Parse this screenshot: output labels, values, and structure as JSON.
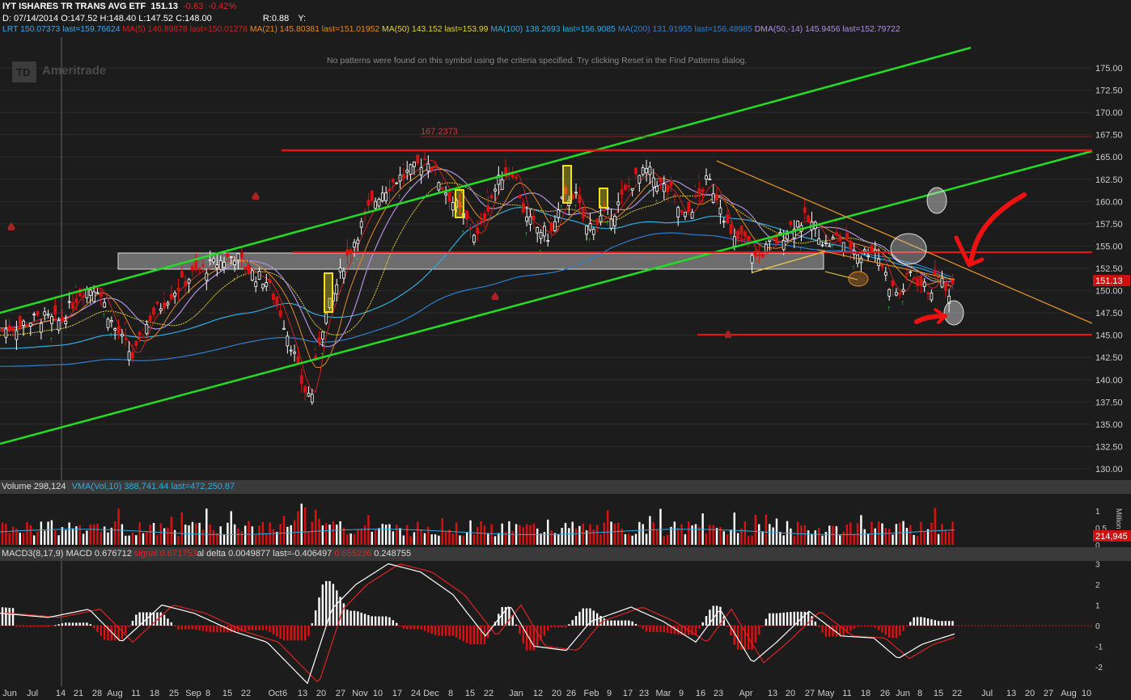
{
  "header": {
    "symbol_line": "IYT ISHARES TR TRANS AVG ETF",
    "price": "151.13",
    "change": "-0.63",
    "change_pct": "-0.42%",
    "ohlc_date": "D: 07/14/2014",
    "open": "O:147.52",
    "high": "H:148.40",
    "low": "L:147.52",
    "close": "C:148.00",
    "r": "R:0.88",
    "y": "Y:"
  },
  "studies": [
    {
      "text": "LRT",
      "color": "#4aa3e0"
    },
    {
      "text": "150.07373 last=159.76624",
      "color": "#4aa3e0"
    },
    {
      "text": "MA(5)",
      "color": "#cc2222"
    },
    {
      "text": "146.89878 last=150.01278",
      "color": "#cc2222"
    },
    {
      "text": "MA(21)",
      "color": "#e08a2a"
    },
    {
      "text": "145.80381 last=151.01952",
      "color": "#e08a2a"
    },
    {
      "text": "MA(50)",
      "color": "#e0d040"
    },
    {
      "text": "143.152 last=153.99",
      "color": "#e0d040"
    },
    {
      "text": "MA(100)",
      "color": "#33aadd"
    },
    {
      "text": "138.2693 last=156.9085",
      "color": "#33aadd"
    },
    {
      "text": "MA(200)",
      "color": "#2f7fd0"
    },
    {
      "text": "131.91955 last=156.48985",
      "color": "#2f7fd0"
    },
    {
      "text": "DMA(50,-14)",
      "color": "#b090e0"
    },
    {
      "text": "145.9456 last=152.79722",
      "color": "#b090e0"
    }
  ],
  "watermark": "Ameritrade",
  "watermark_logo": "TD",
  "pattern_note": "No patterns were found on this symbol using the criteria specified.   Try clicking Reset in the Find Patterns dialog.",
  "high_label": "167.2373",
  "last_price_tag": "151.13",
  "volume_header": {
    "title": "Volume 298,124",
    "vma": "VMA(Vol,10)",
    "vma_values": "388,741.44 last=472,250.87"
  },
  "volume_last_tag": "214,945",
  "volume_unit": "Million",
  "macd_header": {
    "a": "MACD3(8,17,9)",
    "b": "MACD 0.676712",
    "c": "signal 0.671753",
    "d": "al delta 0.0049877 last=-0.406497",
    "e": "0.655236",
    "f": "0.248755"
  },
  "x_labels": [
    {
      "t": "Jun",
      "x": 12
    },
    {
      "t": "Jul",
      "x": 40
    },
    {
      "t": "14",
      "x": 75
    },
    {
      "t": "21",
      "x": 97
    },
    {
      "t": "28",
      "x": 120
    },
    {
      "t": "Aug",
      "x": 142
    },
    {
      "t": "11",
      "x": 168
    },
    {
      "t": "18",
      "x": 191
    },
    {
      "t": "25",
      "x": 215
    },
    {
      "t": "Sep",
      "x": 239
    },
    {
      "t": "8",
      "x": 257
    },
    {
      "t": "15",
      "x": 281
    },
    {
      "t": "22",
      "x": 304
    },
    {
      "t": "Oct",
      "x": 340
    },
    {
      "t": "6",
      "x": 352
    },
    {
      "t": "13",
      "x": 374
    },
    {
      "t": "20",
      "x": 397
    },
    {
      "t": "27",
      "x": 421
    },
    {
      "t": "Nov",
      "x": 445
    },
    {
      "t": "10",
      "x": 467
    },
    {
      "t": "17",
      "x": 491
    },
    {
      "t": "24",
      "x": 514
    },
    {
      "t": "Dec",
      "x": 533
    },
    {
      "t": "8",
      "x": 557
    },
    {
      "t": "15",
      "x": 581
    },
    {
      "t": "22",
      "x": 604
    },
    {
      "t": "Jan",
      "x": 638
    },
    {
      "t": "12",
      "x": 665
    },
    {
      "t": "20",
      "x": 688
    },
    {
      "t": "26",
      "x": 706
    },
    {
      "t": "Feb",
      "x": 731
    },
    {
      "t": "9",
      "x": 753
    },
    {
      "t": "17",
      "x": 776
    },
    {
      "t": "23",
      "x": 796
    },
    {
      "t": "Mar",
      "x": 820
    },
    {
      "t": "9",
      "x": 842
    },
    {
      "t": "16",
      "x": 866
    },
    {
      "t": "23",
      "x": 888
    },
    {
      "t": "Apr",
      "x": 922
    },
    {
      "t": "13",
      "x": 955
    },
    {
      "t": "20",
      "x": 977
    },
    {
      "t": "27",
      "x": 1001
    },
    {
      "t": "May",
      "x": 1021
    },
    {
      "t": "11",
      "x": 1047
    },
    {
      "t": "18",
      "x": 1070
    },
    {
      "t": "26",
      "x": 1094
    },
    {
      "t": "Jun",
      "x": 1116
    },
    {
      "t": "8",
      "x": 1137
    },
    {
      "t": "15",
      "x": 1160
    },
    {
      "t": "22",
      "x": 1183
    },
    {
      "t": "Jul",
      "x": 1220
    },
    {
      "t": "13",
      "x": 1250
    },
    {
      "t": "20",
      "x": 1273
    },
    {
      "t": "27",
      "x": 1296
    },
    {
      "t": "Aug",
      "x": 1321
    },
    {
      "t": "10",
      "x": 1343
    }
  ],
  "colors": {
    "up": "#ffffff",
    "down": "#dd1111",
    "green_line": "#22dd22",
    "red_line": "#ee1111",
    "orange_line": "#e0902a",
    "grid": "#2a2a2a",
    "axis_text": "#cccccc"
  },
  "chart_data": [
    {
      "type": "candlestick",
      "title": "IYT ISHARES TR TRANS AVG ETF",
      "ylim": [
        128.5,
        177.5
      ],
      "y_ticks": [
        "130.00",
        "132.50",
        "135.00",
        "137.50",
        "140.00",
        "142.50",
        "145.00",
        "147.50",
        "150.00",
        "152.50",
        "155.00",
        "157.50",
        "160.00",
        "162.50",
        "165.00",
        "167.50",
        "170.00",
        "172.50",
        "175.00"
      ],
      "x_range": [
        "Jun 2014",
        "Aug 10 2015"
      ],
      "close_path_approx": [
        {
          "date": "Jun 2014",
          "close": 145.5
        },
        {
          "date": "Jul 14",
          "close": 146.5
        },
        {
          "date": "Jul 28",
          "close": 150.5
        },
        {
          "date": "Aug 11",
          "close": 143.0
        },
        {
          "date": "Aug 25",
          "close": 150.0
        },
        {
          "date": "Sep 8",
          "close": 152.5
        },
        {
          "date": "Sep 22",
          "close": 152.0
        },
        {
          "date": "Oct 6",
          "close": 149.0
        },
        {
          "date": "Oct 13",
          "close": 138.5
        },
        {
          "date": "Oct 27",
          "close": 152.0
        },
        {
          "date": "Nov 10",
          "close": 160.0
        },
        {
          "date": "Nov 24",
          "close": 163.5
        },
        {
          "date": "Dec 8",
          "close": 162.0
        },
        {
          "date": "Dec 22",
          "close": 160.5
        },
        {
          "date": "Jan 2015",
          "close": 158.0
        },
        {
          "date": "Jan 26",
          "close": 160.0
        },
        {
          "date": "Feb 9",
          "close": 158.0
        },
        {
          "date": "Feb 23",
          "close": 163.0
        },
        {
          "date": "Mar 9",
          "close": 158.5
        },
        {
          "date": "Mar 23",
          "close": 162.0
        },
        {
          "date": "Apr",
          "close": 154.0
        },
        {
          "date": "Apr 20",
          "close": 156.0
        },
        {
          "date": "May",
          "close": 155.5
        },
        {
          "date": "May 18",
          "close": 154.0
        },
        {
          "date": "Jun 1",
          "close": 150.0
        },
        {
          "date": "Jun 15",
          "close": 149.5
        },
        {
          "date": "Jun 22",
          "close": 151.13
        }
      ],
      "annotations": [
        {
          "label": "resistance",
          "value": 165.8
        },
        {
          "label": "support",
          "value": 154.5
        },
        {
          "label": "support",
          "value": 145.0
        },
        {
          "label": "high",
          "value": 167.2373
        },
        {
          "label": "last",
          "value": 151.13
        }
      ]
    },
    {
      "type": "bar",
      "title": "Volume 298,124",
      "ylabel": "Million",
      "y_ticks": [
        "0",
        "0.5",
        "1"
      ],
      "ylim": [
        0,
        1.3
      ]
    },
    {
      "type": "bar",
      "title": "MACD3(8,17,9)",
      "y_ticks": [
        "3",
        "2",
        "1",
        "0",
        "-1",
        "-2"
      ],
      "ylim": [
        -3,
        3.2
      ]
    }
  ]
}
